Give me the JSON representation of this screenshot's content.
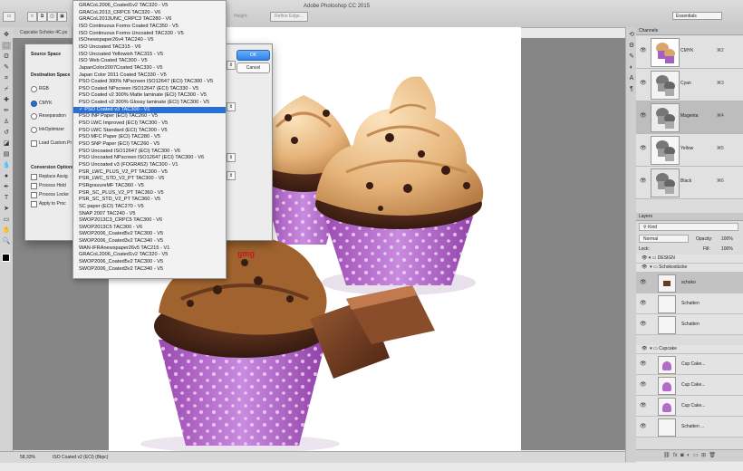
{
  "window": {
    "app_title": "Adobe Photoshop CC 2015",
    "doc_tab": "Cupcake Schoko 4C.ps"
  },
  "optionsbar": {
    "height_label": "Height:",
    "refine_edge": "Refine Edge...",
    "workspace": "Essentials"
  },
  "status": {
    "zoom": "58,33%",
    "profile": "ISO Coated v2 (ECI) (8bpc)"
  },
  "dialog": {
    "source_space": "Source Space",
    "destination_space": "Destination Space",
    "rgb": "RGB",
    "cmyk": "CMYK",
    "reseparation": "Reseparation",
    "inkoptimizer": "InkOptimizer",
    "load_custom": "Load Custom Pr",
    "conversion_options": "Conversion Options",
    "replace": "Replace Assig",
    "process_hidden": "Process Hidd",
    "process_locked": "Process Locke",
    "apply_to": "Apply to Proc",
    "ok": "OK",
    "cancel": "Cancel",
    "logo": "gmg"
  },
  "dropdown": {
    "selected_index": 15,
    "items": [
      "GRACoL2006_Coated1v2 TAC320 - V5",
      "GRACoL2013_CRPC6 TAC320 - V6",
      "GRACoL2013UNC_CRPC3 TAC280 - V6",
      "ISO Continuous Forms Coated TAC350 - V5",
      "ISO Continuous Forms Uncoated TAC330 - V5",
      "ISOnewspaper26v4 TAC240 - V5",
      "ISO Uncoated TAC315 - V6",
      "ISO Uncoated Yellowish TAC315 - V5",
      "ISO Web Coated TAC300 - V5",
      "JapanColor2007Coated TAC330 - V5",
      "Japan Color 2011 Coated TAC330 - V5",
      "PSO Coated 300% NPscreen ISO12647 (ECI) TAC300 - V5",
      "PSO Coated NPscreen ISO12647 (ECI) TAC330 - V5",
      "PSO Coated v2 300% Matte laminate (ECI) TAC300 - V5",
      "PSO Coated v2 300% Glossy laminate (ECI) TAC300 - V5",
      "PSO Coated v3 TAC300 - V1",
      "PSO INP Paper (ECI) TAC260 - V5",
      "PSO LWC Improved (ECI) TAC300 - V5",
      "PSO LWC Standard (ECI) TAC300 - V5",
      "PSO MFC Paper (ECI) TAC280 - V5",
      "PSO SNP Paper (ECI) TAC260 - V5",
      "PSO Uncoated ISO12647 (ECI) TAC300 - V6",
      "PSO Uncoated NPscreen ISO12647 (ECI) TAC300 - V6",
      "PSO Uncoated v3 (FOGRA52) TAC300 - V1",
      "PSR_LWC_PLUS_V2_PT TAC300 - V5",
      "PSR_LWC_STD_V2_PT TAC300 - V5",
      "PSRgravureMF TAC360 - V5",
      "PSR_SC_PLUS_V2_PT TAC360 - V5",
      "PSR_SC_STD_V2_PT TAC360 - V5",
      "SC paper (ECI) TAC270 - V5",
      "SNAP 2007 TAC240 - V5",
      "SWOP2013C3_CRPC5 TAC300 - V6",
      "SWOP2013C5 TAC300 - V6",
      "SWOP2006_Coated5v2 TAC300 - V5",
      "SWOP2006_Coated3v2 TAC340 - V5",
      "WAN-IFRAnewspaper26v5 TAC215 - V1",
      "GRACoL2006_Coated1v2 TAC320 - V5",
      "SWOP2006_Coated5v2 TAC300 - V5",
      "SWOP2006_Coated3v2 TAC340 - V5"
    ]
  },
  "channels": {
    "title": "Channels",
    "items": [
      {
        "name": "CMYK",
        "key": "⌘2"
      },
      {
        "name": "Cyan",
        "key": "⌘3"
      },
      {
        "name": "Magenta",
        "key": "⌘4"
      },
      {
        "name": "Yellow",
        "key": "⌘5"
      },
      {
        "name": "Black",
        "key": "⌘6"
      }
    ]
  },
  "layers": {
    "title": "Layers",
    "kind": "Kind",
    "blend": "Normal",
    "opacity_label": "Opacity:",
    "opacity": "100%",
    "lock_label": "Lock:",
    "fill_label": "Fill:",
    "fill": "100%",
    "group_design": "DESIGN",
    "group_schoko": "Schokostücke",
    "layer_schoko": "schoko",
    "layer_schatten1": "Schatten",
    "layer_schatten2": "Schatten",
    "group_cupcake": "Cupcake",
    "layer_cup1": "Cup Cake...",
    "layer_cup2": "Cup Cake...",
    "layer_cup3": "Cup Cake...",
    "layer_schatten3": "Schatten ..."
  }
}
